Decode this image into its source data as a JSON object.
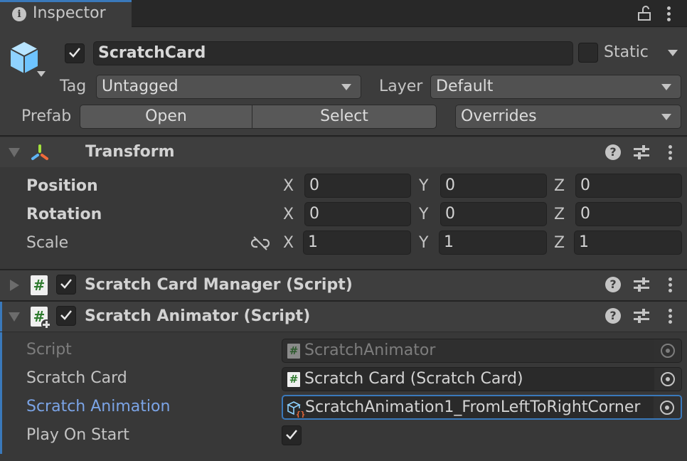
{
  "tab": {
    "title": "Inspector",
    "icon": "info-icon"
  },
  "window_actions": {
    "lock_icon": "lock-open-icon",
    "menu_icon": "kebab-menu-icon"
  },
  "gameobject": {
    "active": true,
    "name": "ScratchCard",
    "static_label": "Static",
    "static_checked": false,
    "tag_label": "Tag",
    "tag_value": "Untagged",
    "layer_label": "Layer",
    "layer_value": "Default",
    "prefab_label": "Prefab",
    "prefab_open": "Open",
    "prefab_select": "Select",
    "prefab_overrides": "Overrides"
  },
  "transform": {
    "title": "Transform",
    "expanded": true,
    "rows": [
      {
        "label": "Position",
        "x": "0",
        "y": "0",
        "z": "0",
        "modified": true
      },
      {
        "label": "Rotation",
        "x": "0",
        "y": "0",
        "z": "0",
        "modified": true
      },
      {
        "label": "Scale",
        "x": "1",
        "y": "1",
        "z": "1",
        "modified": false,
        "constrained": false
      }
    ],
    "axes": [
      "X",
      "Y",
      "Z"
    ]
  },
  "components": [
    {
      "title": "Scratch Card Manager (Script)",
      "enabled": true,
      "expanded": false
    },
    {
      "title": "Scratch Animator (Script)",
      "enabled": true,
      "expanded": true,
      "added_override": true
    }
  ],
  "scratch_animator": {
    "fields": [
      {
        "label": "Script",
        "value": "ScratchAnimator",
        "disabled": true
      },
      {
        "label": "Scratch Card",
        "value": "Scratch Card (Scratch Card)"
      },
      {
        "label": "Scratch Animation",
        "value": "ScratchAnimation1_FromLeftToRightCorner",
        "focused": true
      },
      {
        "label": "Play On Start",
        "checked": true
      }
    ]
  },
  "colors": {
    "accent": "#3a79bb",
    "focused_label": "#7ba4e6",
    "panel": "#383838",
    "field": "#2a2a2a"
  }
}
